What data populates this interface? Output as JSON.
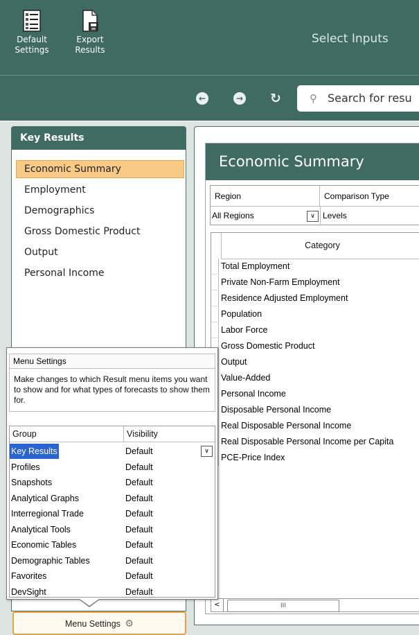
{
  "ribbon": {
    "default_settings_label_1": "Default",
    "default_settings_label_2": "Settings",
    "export_results_label_1": "Export",
    "export_results_label_2": "Results",
    "title": "Select Inputs"
  },
  "nav": {
    "search_placeholder": "Search for resu",
    "back_icon": "arrow-left-icon",
    "forward_icon": "arrow-right-icon",
    "history_icon": "history-icon"
  },
  "key_results": {
    "title": "Key Results",
    "items": [
      {
        "label": "Economic Summary",
        "selected": true
      },
      {
        "label": "Employment"
      },
      {
        "label": "Demographics"
      },
      {
        "label": "Gross Domestic Product"
      },
      {
        "label": "Output"
      },
      {
        "label": "Personal Income"
      }
    ]
  },
  "menu_settings": {
    "title": "Menu Settings",
    "description": "Make changes to which Result menu items you want to show and for what types of forecasts to show them for.",
    "columns": [
      "Group",
      "Visibility"
    ],
    "rows": [
      {
        "group": "Key Results",
        "visibility": "Default",
        "selected": true
      },
      {
        "group": "Profiles",
        "visibility": "Default"
      },
      {
        "group": "Snapshots",
        "visibility": "Default"
      },
      {
        "group": "Analytical Graphs",
        "visibility": "Default"
      },
      {
        "group": "Interregional Trade",
        "visibility": "Default"
      },
      {
        "group": "Analytical Tools",
        "visibility": "Default"
      },
      {
        "group": "Economic Tables",
        "visibility": "Default"
      },
      {
        "group": "Demographic Tables",
        "visibility": "Default"
      },
      {
        "group": "Favorites",
        "visibility": "Default"
      },
      {
        "group": "DevSight",
        "visibility": "Default"
      }
    ],
    "button_label": "Menu Settings"
  },
  "economic_summary": {
    "title": "Economic Summary",
    "filters": {
      "region_label": "Region",
      "region_value": "All Regions",
      "comparison_label": "Comparison Type",
      "comparison_value": "Levels"
    },
    "category_header": "Category",
    "categories": [
      "Total Employment",
      "Private Non-Farm Employment",
      "Residence Adjusted Employment",
      "Population",
      "Labor Force",
      "Gross Domestic Product",
      "Output",
      "Value-Added",
      "Personal Income",
      "Disposable Personal Income",
      "Real Disposable Personal Income",
      "Real Disposable Personal Income per Capita",
      "PCE-Price Index"
    ],
    "scroll_thumb": "III"
  },
  "colors": {
    "ribbon": "#3f6b63",
    "selection": "#f7c984",
    "row_selection": "#2b63d1",
    "button_border": "#e6a24a"
  }
}
